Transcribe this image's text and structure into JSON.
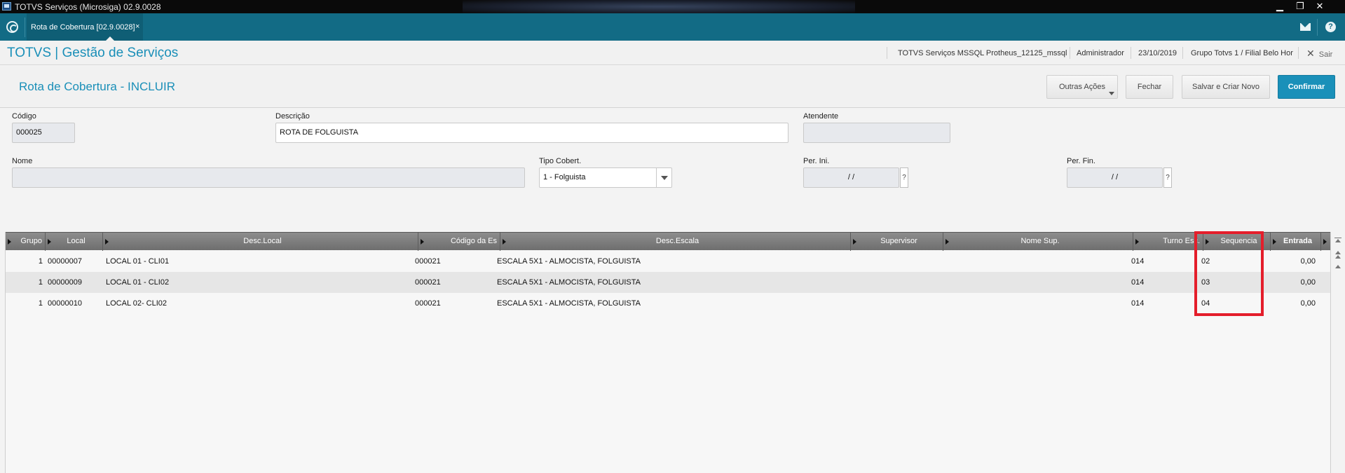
{
  "window": {
    "title": "TOTVS Serviços (Microsiga) 02.9.0028",
    "minimize": "▁",
    "restore": "❐",
    "close": "✕"
  },
  "tabbar": {
    "tab_label": "Rota de Cobertura [02.9.0028]",
    "tab_close": "×",
    "help": "?"
  },
  "header": {
    "brand": "TOTVS | Gestão de Serviços",
    "environment": "TOTVS Serviços MSSQL Protheus_12125_mssql",
    "user": "Administrador",
    "date": "23/10/2019",
    "branch": "Grupo Totvs 1 / Filial Belo Hor",
    "logout": "Sair"
  },
  "page": {
    "title": "Rota de Cobertura - INCLUIR",
    "buttons": {
      "other_actions": "Outras Ações",
      "close": "Fechar",
      "save_new": "Salvar e Criar Novo",
      "confirm": "Confirmar"
    }
  },
  "form": {
    "codigo": {
      "label": "Código",
      "value": "000025"
    },
    "descricao": {
      "label": "Descrição",
      "value": "ROTA DE FOLGUISTA"
    },
    "atendente": {
      "label": "Atendente",
      "value": ""
    },
    "nome": {
      "label": "Nome",
      "value": ""
    },
    "tipo_cobert": {
      "label": "Tipo Cobert.",
      "value": "1 - Folguista"
    },
    "per_ini": {
      "label": "Per. Ini.",
      "value": "/ /",
      "help": "?"
    },
    "per_fin": {
      "label": "Per. Fin.",
      "value": "/ /",
      "help": "?"
    }
  },
  "grid": {
    "columns": [
      "Grupo",
      "Local",
      "Desc.Local",
      "Código da Es",
      "Desc.Escala",
      "Supervisor",
      "Nome Sup.",
      "Turno Esc.",
      "Sequencia",
      "Entrada"
    ],
    "rows": [
      {
        "grupo": "1",
        "local": "00000007",
        "desc_local": "LOCAL 01 - CLI01",
        "codigo_escala": "000021",
        "desc_escala": "ESCALA 5X1 - ALMOCISTA, FOLGUISTA",
        "supervisor": "",
        "nome_sup": "",
        "turno": "014",
        "sequencia": "02",
        "entrada": "0,00"
      },
      {
        "grupo": "1",
        "local": "00000009",
        "desc_local": "LOCAL 01 - CLI02",
        "codigo_escala": "000021",
        "desc_escala": "ESCALA 5X1 - ALMOCISTA, FOLGUISTA",
        "supervisor": "",
        "nome_sup": "",
        "turno": "014",
        "sequencia": "03",
        "entrada": "0,00"
      },
      {
        "grupo": "1",
        "local": "00000010",
        "desc_local": "LOCAL 02- CLI02",
        "codigo_escala": "000021",
        "desc_escala": "ESCALA 5X1 - ALMOCISTA, FOLGUISTA",
        "supervisor": "",
        "nome_sup": "",
        "turno": "014",
        "sequencia": "04",
        "entrada": "0,00"
      }
    ]
  },
  "colors": {
    "brand": "#1a8fb8",
    "tabbar": "#126b85",
    "primary_button": "#1a90b9",
    "highlight": "#e41e2b"
  }
}
